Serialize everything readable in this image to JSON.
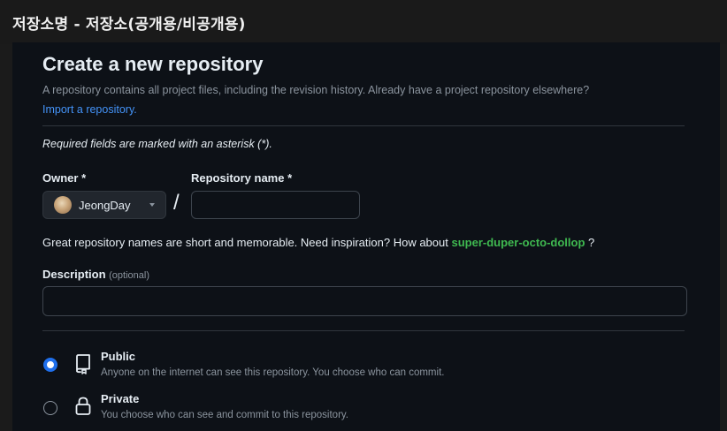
{
  "window": {
    "title": "저장소명 - 저장소(공개용/비공개용)"
  },
  "form": {
    "heading": "Create a new repository",
    "subtitle": "A repository contains all project files, including the revision history. Already have a project repository elsewhere?",
    "import_link": "Import a repository.",
    "required_note": "Required fields are marked with an asterisk (*).",
    "owner": {
      "label": "Owner *",
      "value": "JeongDay"
    },
    "separator": "/",
    "repo_name": {
      "label": "Repository name *",
      "value": ""
    },
    "suggestion": {
      "prefix": "Great repository names are short and memorable. Need inspiration? How about",
      "name": "super-duper-octo-dollop",
      "suffix": "?"
    },
    "description": {
      "label": "Description",
      "optional": "(optional)",
      "value": ""
    },
    "visibility": [
      {
        "title": "Public",
        "description": "Anyone on the internet can see this repository. You choose who can commit.",
        "selected": true,
        "icon": "repo-icon"
      },
      {
        "title": "Private",
        "description": "You choose who can see and commit to this repository.",
        "selected": false,
        "icon": "lock-icon"
      }
    ]
  },
  "colors": {
    "accent_link": "#4493f8",
    "suggestion_green": "#3fb950",
    "radio_selected": "#1f6feb",
    "panel_bg": "#0d1117"
  }
}
